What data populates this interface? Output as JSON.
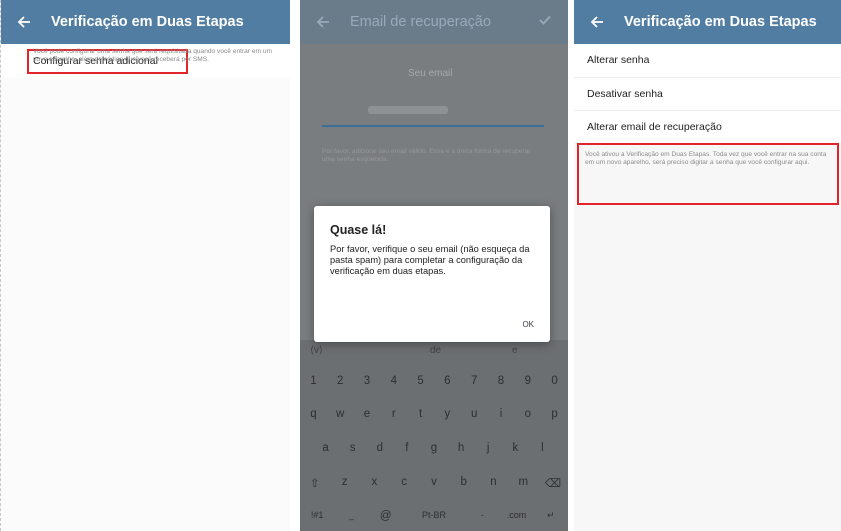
{
  "panel1": {
    "title": "Verificação em Duas Etapas",
    "config_label": "Configurar senha adicional",
    "description": "Você pode configurar uma senha que será requisitada quando você entrar em um novo aparelho, além do código que você receberá por SMS."
  },
  "panel2": {
    "title": "Email de recuperação",
    "field_label": "Seu email",
    "help_text": "Por favor, adicione seu email válido. Essa é a única forma de recuperar uma senha esquecida.",
    "dialog": {
      "title": "Quase lá!",
      "body": "Por favor, verifique o seu email (não esqueça da pasta spam) para completar a configuração da verificação em duas etapas.",
      "ok": "OK"
    },
    "keyboard": {
      "suggestions": [
        "de",
        "e"
      ],
      "numbers": [
        "1",
        "2",
        "3",
        "4",
        "5",
        "6",
        "7",
        "8",
        "9",
        "0"
      ],
      "row1": [
        "q",
        "w",
        "e",
        "r",
        "t",
        "y",
        "u",
        "i",
        "o",
        "p"
      ],
      "row2": [
        "a",
        "s",
        "d",
        "f",
        "g",
        "h",
        "j",
        "k",
        "l"
      ],
      "row3": [
        "⇧",
        "z",
        "x",
        "c",
        "v",
        "b",
        "n",
        "m",
        "⌫"
      ],
      "row4": [
        "!#1",
        "_",
        "@",
        "Pt-BR",
        "-",
        ".com",
        "↵"
      ]
    }
  },
  "panel3": {
    "title": "Verificação em Duas Etapas",
    "items": [
      "Alterar senha",
      "Desativar senha",
      "Alterar email de recuperação"
    ],
    "description": "Você ativou a Verificação em Duas Etapas. Toda vez que você entrar na sua conta em um novo aparelho, será preciso digitar a senha que você configurar aqui."
  },
  "colors": {
    "appbar": "#517da2",
    "highlight": "#e0242a",
    "input_line": "#3b6f98"
  }
}
